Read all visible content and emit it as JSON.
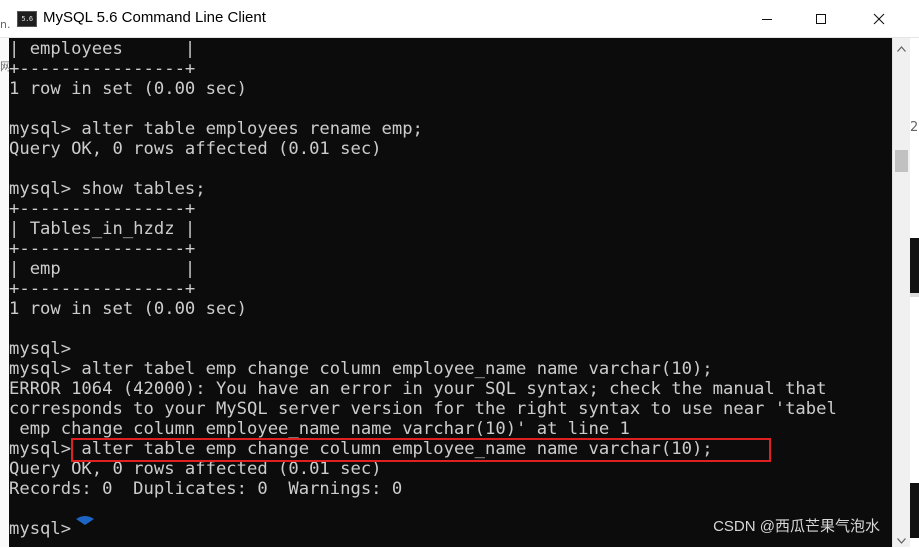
{
  "window": {
    "title": "MySQL 5.6 Command Line Client",
    "app_icon_label": "5.6",
    "controls": {
      "minimize": "minimize-icon",
      "maximize": "maximize-icon",
      "close": "close-icon"
    }
  },
  "console": {
    "lines": [
      "| employees      |",
      "+----------------+",
      "1 row in set (0.00 sec)",
      "",
      "mysql> alter table employees rename emp;",
      "Query OK, 0 rows affected (0.01 sec)",
      "",
      "mysql> show tables;",
      "+----------------+",
      "| Tables_in_hzdz |",
      "+----------------+",
      "| emp            |",
      "+----------------+",
      "1 row in set (0.00 sec)",
      "",
      "mysql>",
      "mysql> alter tabel emp change column employee_name name varchar(10);",
      "ERROR 1064 (42000): You have an error in your SQL syntax; check the manual that",
      "corresponds to your MySQL server version for the right syntax to use near 'tabel",
      " emp change column employee_name name varchar(10)' at line 1",
      "mysql> alter table emp change column employee_name name varchar(10);",
      "Query OK, 0 rows affected (0.01 sec)",
      "Records: 0  Duplicates: 0  Warnings: 0",
      "",
      "mysql>"
    ],
    "highlighted_line_index": 20,
    "watermark": "CSDN @西瓜芒果气泡水"
  },
  "background": {
    "left_glyphs": [
      "n.",
      "网"
    ],
    "right_glyphs": [
      "2"
    ]
  },
  "colors": {
    "console_bg": "#0c0c0c",
    "console_text": "#cccccc",
    "highlight_border": "#e02020",
    "cursor_blue": "#1e6fd9"
  }
}
